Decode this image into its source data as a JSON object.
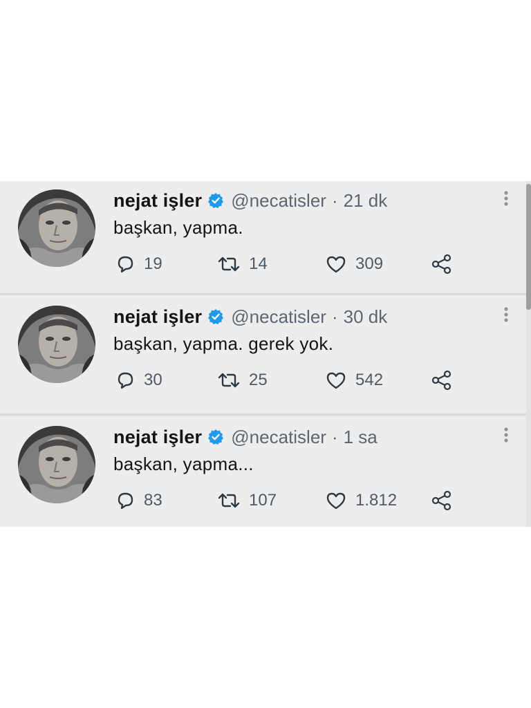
{
  "tweets": [
    {
      "name": "nejat işler",
      "handle": "@necatisler",
      "separator": "·",
      "time": "21 dk",
      "text": "başkan, yapma.",
      "replies": "19",
      "retweets": "14",
      "likes": "309"
    },
    {
      "name": "nejat işler",
      "handle": "@necatisler",
      "separator": "·",
      "time": "30 dk",
      "text": "başkan, yapma. gerek yok.",
      "replies": "30",
      "retweets": "25",
      "likes": "542"
    },
    {
      "name": "nejat işler",
      "handle": "@necatisler",
      "separator": "·",
      "time": "1 sa",
      "text": "başkan, yapma...",
      "replies": "83",
      "retweets": "107",
      "likes": "1.812"
    }
  ],
  "icons": {
    "verified": "verified-badge-icon",
    "reply": "reply-bubble-icon",
    "retweet": "retweet-arrows-icon",
    "like": "heart-icon",
    "share": "share-nodes-icon",
    "more": "more-vertical-dots-icon"
  },
  "colors": {
    "verified": "#1d9bf0",
    "background": "#ededed",
    "text": "#141414",
    "muted": "#5c6670"
  }
}
